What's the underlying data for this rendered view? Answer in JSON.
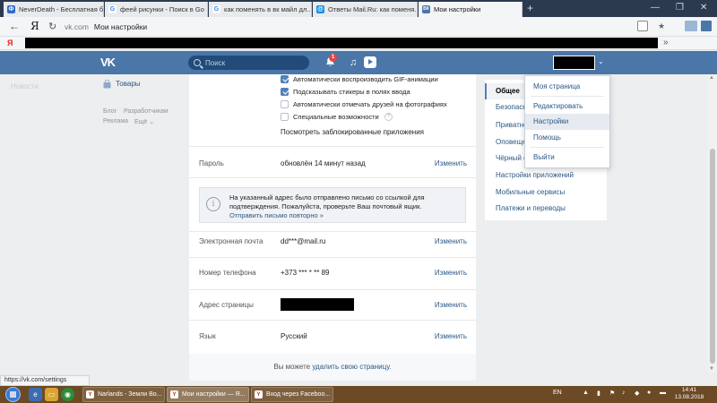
{
  "browser": {
    "tabs": [
      {
        "label": "NeverDeath - Бесплатная б...",
        "icon": "Ф",
        "color": "#2f6cc9"
      },
      {
        "label": "феей рисунки - Поиск в Go",
        "icon": "G",
        "color": "#4285f4"
      },
      {
        "label": "как поменять в вк майл дл...",
        "icon": "G",
        "color": "#4285f4"
      },
      {
        "label": "Ответы Mail.Ru: как поменя...",
        "icon": "@",
        "color": "#168de2"
      },
      {
        "label": "Мои настройки",
        "icon": "ВК",
        "color": "#4a76a8"
      }
    ],
    "new_tab": "+",
    "url_domain": "vk.com",
    "url_title": "Мои настройки",
    "back": "←",
    "ya": "Я",
    "refresh": "↻",
    "bm_ya": "Я",
    "bm_more": "»",
    "win_min": "—",
    "win_max": "❐",
    "win_close": "✕",
    "star": "★",
    "status_url": "https://vk.com/settings"
  },
  "vk": {
    "logo": "VK",
    "search_placeholder": "Поиск",
    "notification_count": "1",
    "music_icon": "♫"
  },
  "leftnav": {
    "faded_item": "Новости",
    "products": "Товары",
    "footer_links": [
      "Блог",
      "Разработчикам",
      "Реклама",
      "Ещё ⌄"
    ]
  },
  "settings": {
    "checkboxes": [
      {
        "label": "Автоматически воспроизводить GIF-анимации",
        "checked": true
      },
      {
        "label": "Подсказывать стикеры в полях ввода",
        "checked": true
      },
      {
        "label": "Автоматически отмечать друзей на фотографиях",
        "checked": false
      },
      {
        "label": "Специальные возможности",
        "checked": false
      }
    ],
    "help_glyph": "?",
    "blocked_apps_link": "Посмотреть заблокированные приложения",
    "password_label": "Пароль",
    "password_value": "обновлён 14 минут назад",
    "change": "Изменить",
    "notice_text": "На указанный адрес было отправлено письмо со ссылкой для подтверждения. Пожалуйста, проверьте Ваш почтовый ящик.",
    "notice_link": "Отправить письмо повторно »",
    "notice_icon": "i",
    "email_label": "Электронная почта",
    "email_value": "dd***@mail.ru",
    "phone_label": "Номер телефона",
    "phone_value": "+373 *** * ** 89",
    "address_label": "Адрес страницы",
    "language_label": "Язык",
    "language_value": "Русский",
    "footer_prefix": "Вы можете ",
    "footer_link": "удалить свою страницу."
  },
  "rightmenu": {
    "items": [
      "Общее",
      "Безопасность",
      "Приватность",
      "Оповещения",
      "Чёрный список",
      "Настройки приложений",
      "Мобильные сервисы",
      "Платежи и переводы"
    ]
  },
  "dropdown": {
    "items": [
      "Моя страница",
      "Редактировать",
      "Настройки",
      "Помощь",
      "Выйти"
    ]
  },
  "taskbar": {
    "buttons": [
      {
        "label": "Narlands - Земли Во...",
        "icon": "Y",
        "color": "#e52620"
      },
      {
        "label": "Мои настройки — Я...",
        "icon": "Y",
        "color": "#e52620"
      },
      {
        "label": "Вход через Faceboo...",
        "icon": "Y",
        "color": "#e52620"
      }
    ],
    "lang": "EN",
    "time": "14:41",
    "date": "13.08.2018"
  }
}
